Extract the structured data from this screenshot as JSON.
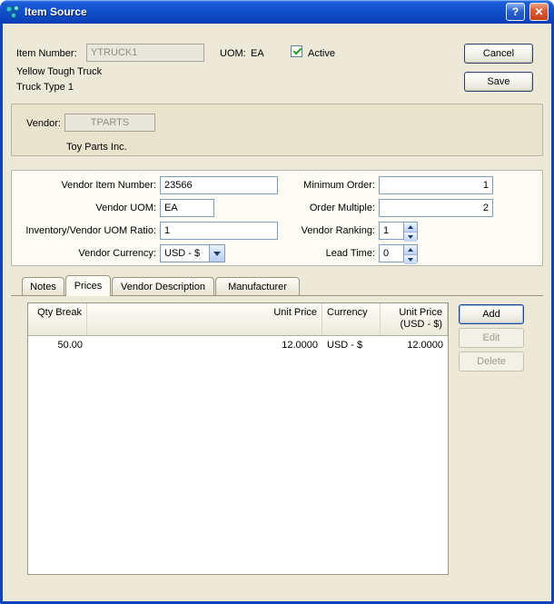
{
  "window": {
    "title": "Item Source",
    "help_glyph": "?",
    "close_glyph": "✕"
  },
  "header": {
    "item_number_label": "Item Number:",
    "item_number_value": "YTRUCK1",
    "uom_label": "UOM:",
    "uom_value": "EA",
    "active_label": "Active",
    "active_checked": true,
    "description_line1": "Yellow Tough Truck",
    "description_line2": "Truck Type 1",
    "cancel_button": "Cancel",
    "save_button": "Save"
  },
  "vendor": {
    "label": "Vendor:",
    "code": "TPARTS",
    "name": "Toy Parts Inc."
  },
  "details": {
    "vendor_item_number": {
      "label": "Vendor Item Number:",
      "value": "23566"
    },
    "vendor_uom": {
      "label": "Vendor UOM:",
      "value": "EA"
    },
    "uom_ratio": {
      "label": "Inventory/Vendor UOM Ratio:",
      "value": "1"
    },
    "vendor_currency": {
      "label": "Vendor Currency:",
      "value": "USD - $"
    },
    "minimum_order": {
      "label": "Minimum Order:",
      "value": "1"
    },
    "order_multiple": {
      "label": "Order Multiple:",
      "value": "2"
    },
    "vendor_ranking": {
      "label": "Vendor Ranking:",
      "value": "1"
    },
    "lead_time": {
      "label": "Lead Time:",
      "value": "0"
    }
  },
  "tabs": [
    {
      "label": "Notes",
      "active": false
    },
    {
      "label": "Prices",
      "active": true
    },
    {
      "label": "Vendor Description",
      "active": false
    },
    {
      "label": "Manufacturer",
      "active": false
    }
  ],
  "prices": {
    "columns": [
      {
        "label": "Qty Break"
      },
      {
        "label": "Unit Price"
      },
      {
        "label": "Currency"
      },
      {
        "label": "Unit Price",
        "label2": "(USD - $)"
      }
    ],
    "rows": [
      {
        "qty_break": "50.00",
        "unit_price": "12.0000",
        "currency": "USD - $",
        "unit_price_usd": "12.0000"
      }
    ],
    "add_button": "Add",
    "edit_button": "Edit",
    "delete_button": "Delete"
  },
  "colors": {
    "titlebar_blue": "#1250cc",
    "close_red": "#dd5f38",
    "check_green": "#21a51e",
    "body_beige": "#ece9d8"
  }
}
